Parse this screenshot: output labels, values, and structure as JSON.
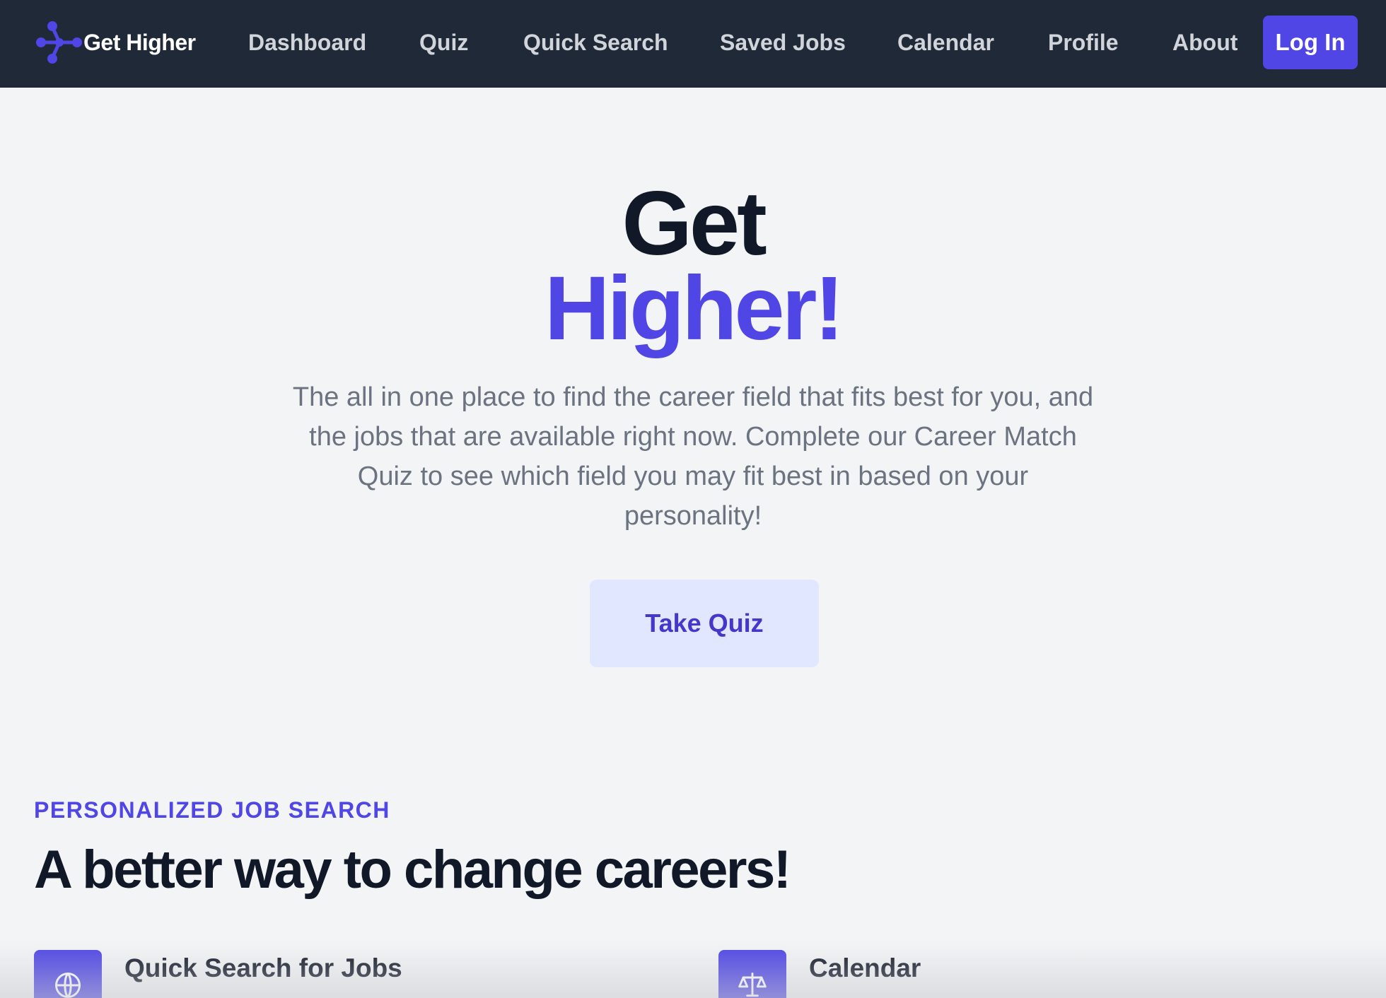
{
  "nav": {
    "brand": "Get Higher",
    "links": [
      "Dashboard",
      "Quiz",
      "Quick Search",
      "Saved Jobs",
      "Calendar",
      "Profile",
      "About"
    ],
    "login_label": "Log In",
    "logo_icon": "molecule-logo-icon"
  },
  "hero": {
    "line1": "Get",
    "line2": "Higher!",
    "description": "The all in one place to find the career field that fits best for you, and the jobs that are available right now. Complete our Career Match Quiz to see which field you may fit best in based on your personality!",
    "cta_label": "Take Quiz"
  },
  "features_section": {
    "eyebrow": "PERSONALIZED JOB SEARCH",
    "title": "A better way to change careers!",
    "items": [
      {
        "title": "Quick Search for Jobs",
        "icon": "globe-icon"
      },
      {
        "title": "Calendar",
        "icon": "scale-icon"
      }
    ]
  },
  "colors": {
    "accent": "#4f46e5",
    "nav_bg": "#1f2937",
    "page_bg": "#f3f4f6",
    "cta_bg": "#e0e7ff"
  }
}
